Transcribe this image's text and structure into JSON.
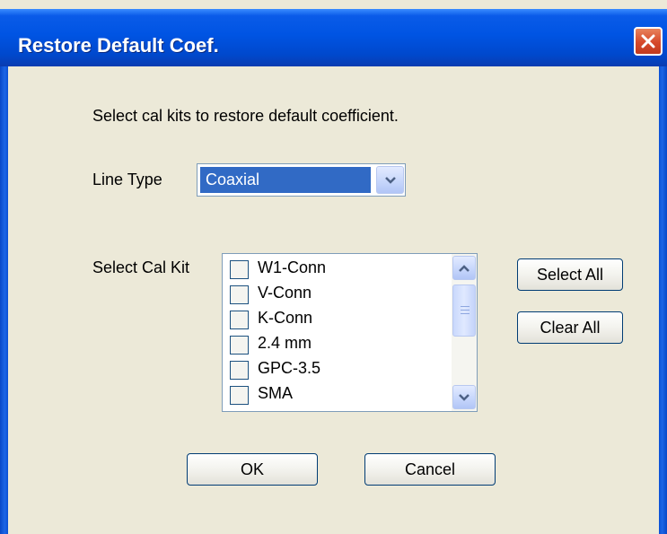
{
  "dialog": {
    "title": "Restore Default Coef.",
    "instruction": "Select cal kits to restore default coefficient."
  },
  "line_type": {
    "label": "Line Type",
    "selected": "Coaxial"
  },
  "cal_kit": {
    "label": "Select Cal Kit",
    "items": [
      {
        "label": "W1-Conn",
        "checked": false
      },
      {
        "label": "V-Conn",
        "checked": false
      },
      {
        "label": "K-Conn",
        "checked": false
      },
      {
        "label": "2.4 mm",
        "checked": false
      },
      {
        "label": "GPC-3.5",
        "checked": false
      },
      {
        "label": "SMA",
        "checked": false
      }
    ]
  },
  "buttons": {
    "select_all": "Select All",
    "clear_all": "Clear All",
    "ok": "OK",
    "cancel": "Cancel"
  },
  "colors": {
    "title_bar": "#0054E3",
    "dialog_face": "#ECE9D8",
    "selection": "#316AC5",
    "close_button": "#D6492A"
  },
  "icons": {
    "close": "close-icon",
    "dropdown": "chevron-down-icon",
    "scroll_up": "chevron-up-icon",
    "scroll_down": "chevron-down-icon"
  }
}
